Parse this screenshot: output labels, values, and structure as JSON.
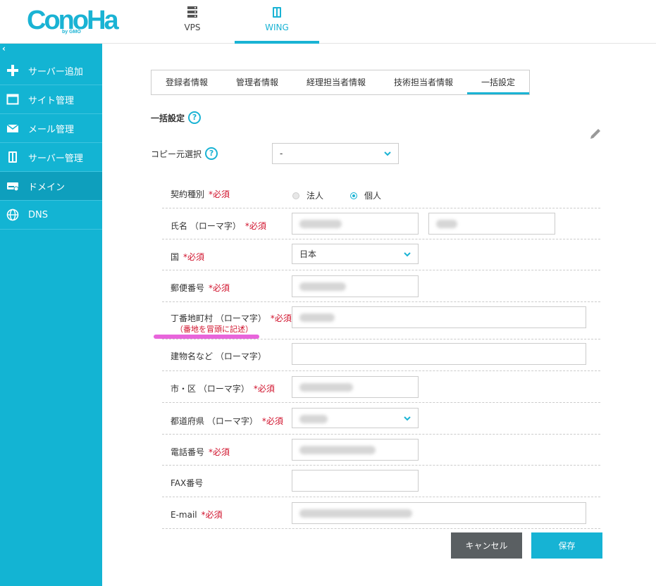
{
  "header": {
    "logo_main": "ConoHa",
    "logo_sub": "by GMO",
    "tabs": [
      {
        "label": "VPS",
        "icon": "server-icon"
      },
      {
        "label": "WING",
        "icon": "wing-icon",
        "active": true
      }
    ]
  },
  "sidebar": {
    "collapse_label": "‹",
    "items": [
      {
        "label": "サーバー追加",
        "icon": "plus-icon"
      },
      {
        "label": "サイト管理",
        "icon": "window-icon"
      },
      {
        "label": "メール管理",
        "icon": "mail-icon"
      },
      {
        "label": "サーバー管理",
        "icon": "server-icon"
      },
      {
        "label": "ドメイン",
        "icon": "domain-icon",
        "active": true
      },
      {
        "label": "DNS",
        "icon": "globe-icon"
      }
    ]
  },
  "tabs": [
    {
      "label": "登録者情報"
    },
    {
      "label": "管理者情報"
    },
    {
      "label": "経理担当者情報"
    },
    {
      "label": "技術担当者情報"
    },
    {
      "label": "一括設定",
      "active": true
    }
  ],
  "section": {
    "title": "一括設定",
    "help": "?"
  },
  "copy": {
    "label": "コピー元選択",
    "help": "?",
    "value": "-"
  },
  "form": {
    "required_mark": "*必須",
    "contract_type": {
      "label": "契約種別",
      "options": [
        "法人",
        "個人"
      ],
      "selected": "個人"
    },
    "name": {
      "label": "氏名 （ローマ字）"
    },
    "country": {
      "label": "国",
      "value": "日本"
    },
    "postal": {
      "label": "郵便番号"
    },
    "address": {
      "label": "丁番地町村 （ローマ字）",
      "note": "（番地を冒頭に記述）"
    },
    "building": {
      "label": "建物名など （ローマ字）"
    },
    "city": {
      "label": "市・区 （ローマ字）"
    },
    "prefecture": {
      "label": "都道府県 （ローマ字）"
    },
    "phone": {
      "label": "電話番号"
    },
    "fax": {
      "label": "FAX番号"
    },
    "email": {
      "label": "E-mail"
    }
  },
  "buttons": {
    "cancel": "キャンセル",
    "save": "保存"
  },
  "colors": {
    "accent": "#13b4d3",
    "required": "#d0112b",
    "cancel": "#5a5f62"
  }
}
